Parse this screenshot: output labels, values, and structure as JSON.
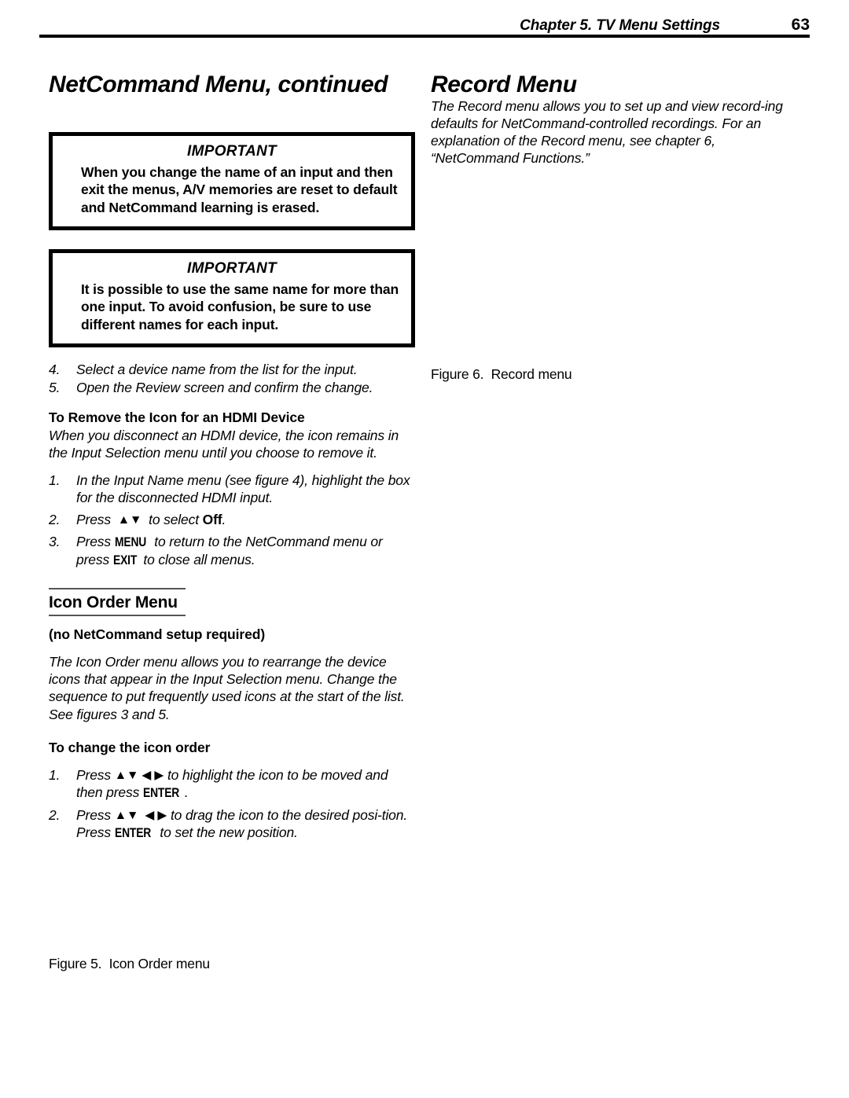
{
  "header": {
    "chapter": "Chapter 5. TV Menu Settings",
    "page_number": "63"
  },
  "left_column": {
    "section_title": "NetCommand Menu, continued",
    "important_1": {
      "title": "IMPORTANT",
      "body": "When you change the name of an input and then exit the menus, A/V memories are reset to default and NetCommand learning is erased."
    },
    "important_2": {
      "title": "IMPORTANT",
      "body": "It is possible to use the same name for more than one input.  To avoid confusion, be sure to use different names for each input."
    },
    "steps_continued": [
      {
        "num": "4.",
        "text": "Select a device name from the list for the input."
      },
      {
        "num": "5.",
        "text": "Open the Review screen and confirm the change."
      }
    ],
    "hdmi_section": {
      "heading": "To Remove the Icon for an HDMI Device",
      "intro": "When you disconnect an HDMI device, the icon remains in the Input Selection menu until you choose to remove it.",
      "steps": [
        {
          "num": "1.",
          "parts": [
            {
              "type": "text",
              "value": "In the Input Name menu (see figure 4), highlight the box for the disconnected HDMI input."
            }
          ]
        },
        {
          "num": "2.",
          "parts": [
            {
              "type": "text",
              "value": "Press "
            },
            {
              "type": "arrows",
              "value": "up-down"
            },
            {
              "type": "text",
              "value": " to select "
            },
            {
              "type": "bold",
              "value": "Off"
            },
            {
              "type": "text",
              "value": "."
            }
          ]
        },
        {
          "num": "3.",
          "parts": [
            {
              "type": "text",
              "value": "Press "
            },
            {
              "type": "key",
              "value": "MENU"
            },
            {
              "type": "text",
              "value": " to return to the NetCommand menu or press "
            },
            {
              "type": "key",
              "value": "EXIT"
            },
            {
              "type": "text",
              "value": " to close all menus."
            }
          ]
        }
      ]
    },
    "icon_order_section": {
      "heading": "Icon Order Menu",
      "subheading": "(no NetCommand setup required)",
      "intro": "The Icon Order menu allows you to rearrange the device icons that appear in the Input Selection menu.  Change the sequence to put frequently used icons at the start of the list.  See figures 3 and 5.",
      "procedure_heading": "To change the icon order",
      "steps": [
        {
          "num": "1.",
          "parts": [
            {
              "type": "text",
              "value": "Press "
            },
            {
              "type": "arrows",
              "value": "up-down-left-right"
            },
            {
              "type": "text",
              "value": " to highlight the icon to be moved and then press "
            },
            {
              "type": "key",
              "value": "ENTER"
            },
            {
              "type": "text",
              "value": "."
            }
          ]
        },
        {
          "num": "2.",
          "parts": [
            {
              "type": "text",
              "value": "Press "
            },
            {
              "type": "arrows",
              "value": "up-down-left-right"
            },
            {
              "type": "text",
              "value": " to drag the icon to the desired posi-tion.  Press "
            },
            {
              "type": "key",
              "value": "ENTER"
            },
            {
              "type": "text",
              "value": " to set the new position."
            }
          ]
        }
      ]
    },
    "figure_caption": "Figure 5.  Icon Order menu"
  },
  "right_column": {
    "section_title": "Record Menu",
    "intro": "The Record menu allows you to set up and view record-ing defaults for NetCommand-controlled recordings. For an explanation of the Record menu, see chapter 6, “NetCommand Functions.”",
    "figure_caption": "Figure 6.  Record menu"
  },
  "icons": {
    "arrow_up": "▲",
    "arrow_down": "▼",
    "arrow_left": "◀",
    "arrow_right": "▶"
  },
  "colors": {
    "text": "#000000",
    "background": "#ffffff",
    "rule": "#555555"
  }
}
